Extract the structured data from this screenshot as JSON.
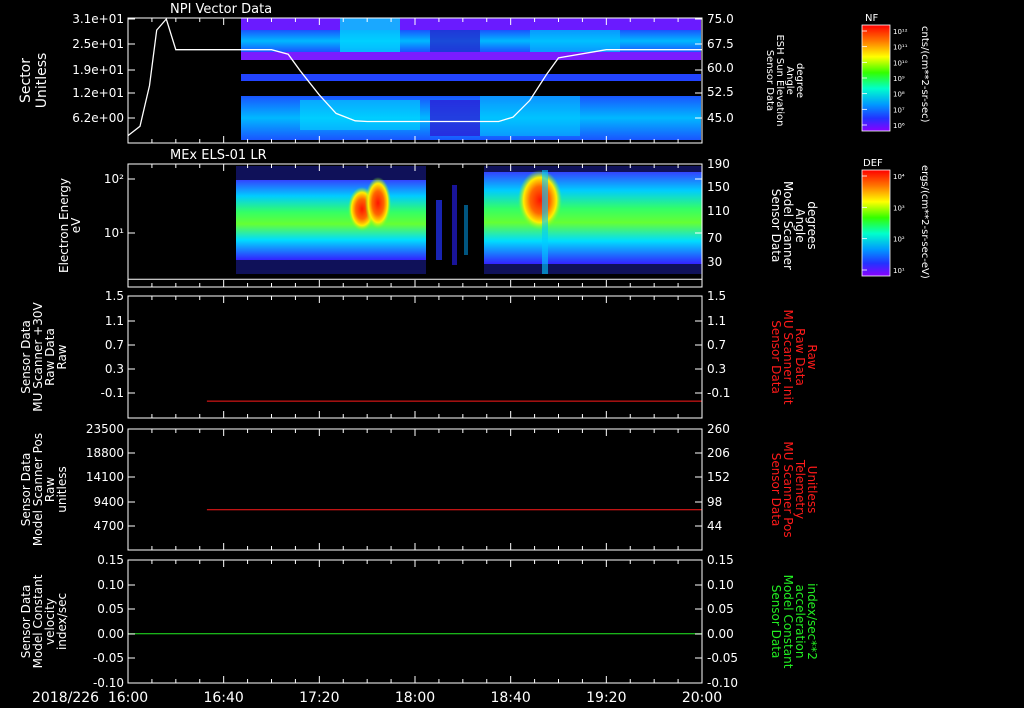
{
  "time": {
    "date": "2018/226",
    "ticks": [
      "16:00",
      "16:40",
      "17:20",
      "18:00",
      "18:40",
      "19:20",
      "20:00"
    ]
  },
  "colors": {
    "background": "#000000",
    "axis": "#ffffff",
    "red_series": "#ff1a1a",
    "green_series": "#22ee22",
    "cbar_top": "#ff0000",
    "cbar_bottom": "#7a00ff"
  },
  "chart_data": [
    {
      "type": "heatmap",
      "title": "NPI Vector Data",
      "ylabel_lines": [
        "Sector",
        "Unitless"
      ],
      "yticks": [
        "3.1e+01",
        "2.5e+01",
        "1.9e+01",
        "1.2e+01",
        "6.2e+00"
      ],
      "ylabel2_lines": [
        "Sensor Data",
        "ESH Sun Elevation",
        "Angle",
        "degree"
      ],
      "y2ticks": [
        "75.0",
        "67.5",
        "60.0",
        "52.5",
        "45.0"
      ],
      "y2lim": [
        41.5,
        75.0
      ],
      "overlay_line": {
        "name": "ESH Sun Elevation Angle",
        "x": [
          "16:00",
          "16:05",
          "16:09",
          "16:12",
          "16:16",
          "16:20",
          "16:40",
          "17:00",
          "17:07",
          "17:12",
          "17:20",
          "17:27",
          "17:35",
          "17:40",
          "18:00",
          "18:20",
          "18:35",
          "18:41",
          "18:48",
          "18:55",
          "19:00",
          "19:20",
          "20:00"
        ],
        "y": [
          43.5,
          46.0,
          57.0,
          72.0,
          75.0,
          66.7,
          66.7,
          66.7,
          65.5,
          61.0,
          54.5,
          49.5,
          47.5,
          47.3,
          47.3,
          47.3,
          47.3,
          48.5,
          53.0,
          60.0,
          64.5,
          66.7,
          66.7
        ]
      },
      "colorbar": {
        "label": "NF",
        "units": "cnts/(cm**2-sr-sec)",
        "ticks": [
          "10¹²",
          "10¹¹",
          "10¹⁰",
          "10⁹",
          "10⁸",
          "10⁷",
          "10⁶"
        ]
      },
      "data_start": "16:40"
    },
    {
      "type": "heatmap",
      "title": "MEx ELS-01 LR",
      "ylabel_lines": [
        "Electron Energy",
        "eV"
      ],
      "yticks": [
        "10²",
        "10¹"
      ],
      "ylabel2_lines": [
        "Sensor Data",
        "Model Scanner",
        "Angle",
        "degrees"
      ],
      "y2ticks": [
        "190",
        "150",
        "110",
        "70",
        "30"
      ],
      "y2lim": [
        0,
        190
      ],
      "overlay_line": {
        "name": "Model Scanner Angle",
        "x": [
          "16:00",
          "20:00"
        ],
        "y": [
          12,
          12
        ]
      },
      "colorbar": {
        "label": "DEF",
        "units": "ergs/(cm**2-sr-sec-eV)",
        "ticks": [
          "10⁴",
          "10³",
          "10²",
          "10¹"
        ]
      },
      "data_start": "16:37"
    },
    {
      "type": "line",
      "ylabel_lines": [
        "Sensor Data",
        "MU Scanner +30V",
        "Raw Data",
        "Raw"
      ],
      "yticks": [
        "1.5",
        "1.1",
        "0.7",
        "0.3",
        "-0.1"
      ],
      "ylim": [
        -0.3,
        1.5
      ],
      "ylabel2_lines": [
        "Sensor Data",
        "MU Scanner Init",
        "Raw Data",
        "Raw"
      ],
      "y2ticks": [
        "1.5",
        "1.1",
        "0.7",
        "0.3",
        "-0.1"
      ],
      "series": [
        {
          "x": [
            "16:33",
            "20:00"
          ],
          "y": [
            -0.05,
            -0.05
          ]
        }
      ]
    },
    {
      "type": "line",
      "ylabel_lines": [
        "Sensor Data",
        "Model Scanner Pos",
        "Raw",
        "unitless"
      ],
      "yticks": [
        "23500",
        "18800",
        "14100",
        "9400",
        "4700"
      ],
      "ylim": [
        0,
        23500
      ],
      "ylabel2_lines": [
        "Sensor Data",
        "MU Scanner Pos",
        "Telemetry",
        "Unitless"
      ],
      "y2ticks": [
        "260",
        "206",
        "152",
        "98",
        "44"
      ],
      "series": [
        {
          "x": [
            "16:33",
            "20:00"
          ],
          "y": [
            7800,
            7800
          ]
        }
      ]
    },
    {
      "type": "line",
      "ylabel_lines": [
        "Sensor Data",
        "Model Constant",
        "velocity",
        "index/sec"
      ],
      "yticks": [
        "0.15",
        "0.10",
        "0.05",
        "0.00",
        "-0.05",
        "-0.10"
      ],
      "ylim": [
        -0.1,
        0.15
      ],
      "ylabel2_lines": [
        "Sensor Data",
        "Model Constant",
        "acceleration",
        "index/sec**2"
      ],
      "y2ticks": [
        "0.15",
        "0.10",
        "0.05",
        "0.00",
        "-0.05",
        "-0.10"
      ],
      "series": [
        {
          "x": [
            "16:00",
            "20:00"
          ],
          "y": [
            0.0,
            0.0
          ]
        }
      ]
    }
  ]
}
